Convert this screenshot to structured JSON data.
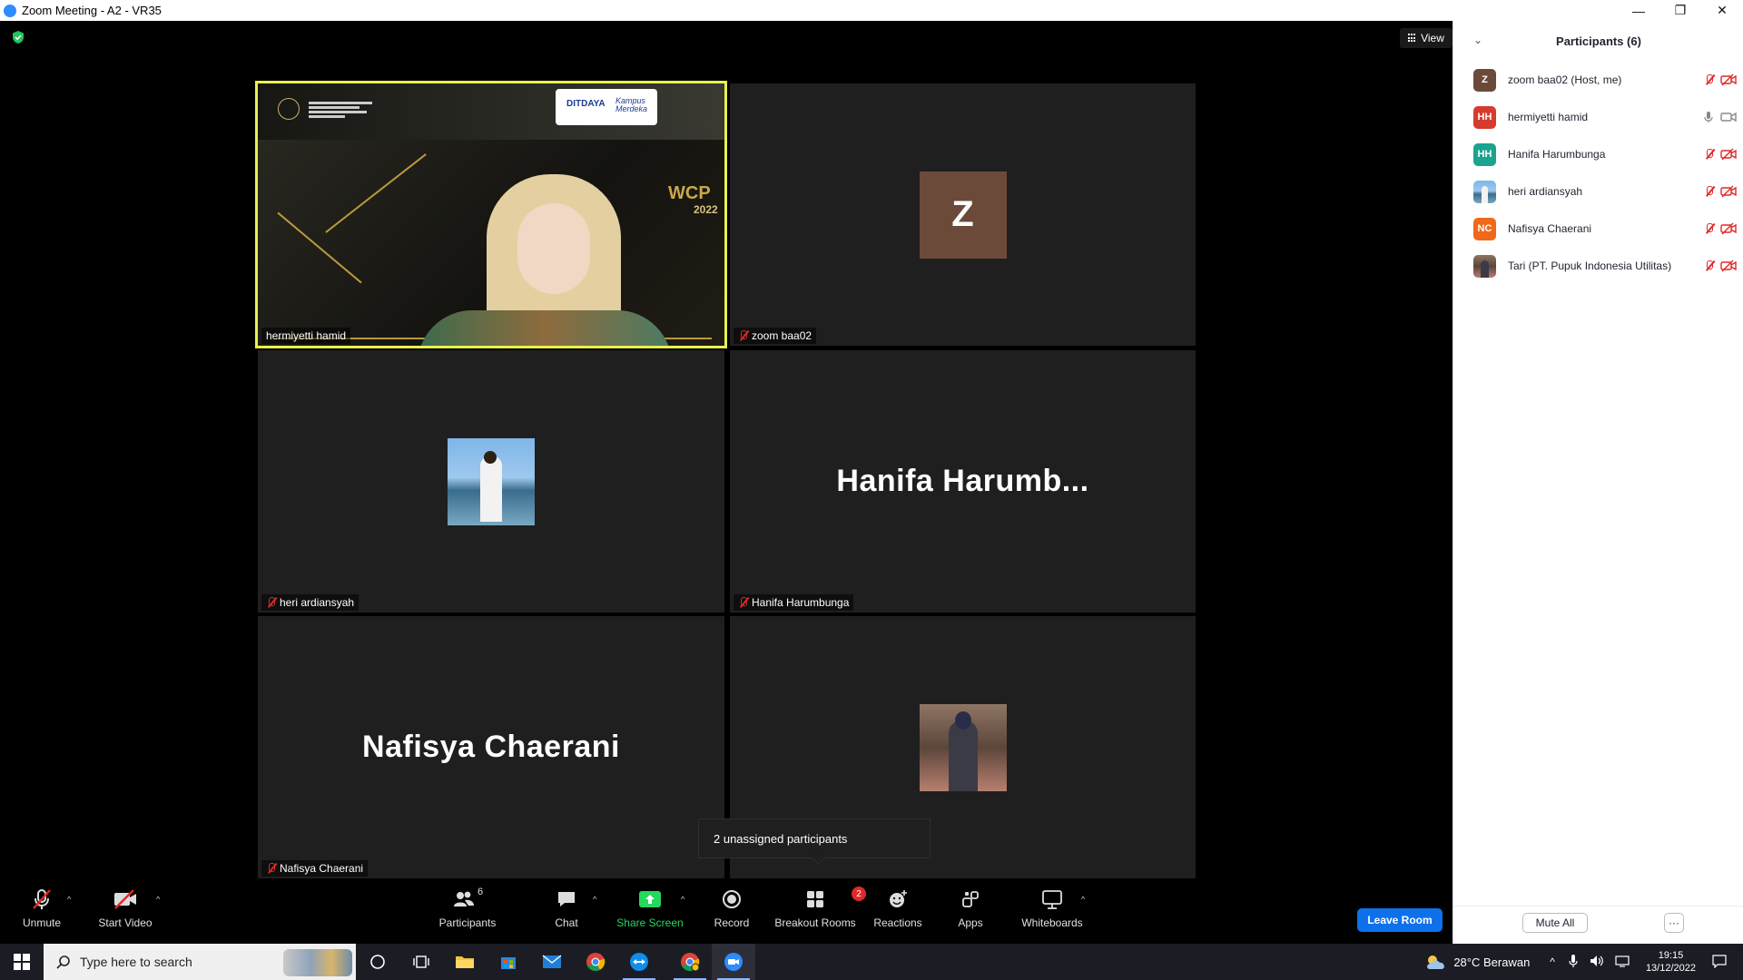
{
  "window": {
    "title": "Zoom Meeting - A2 - VR35",
    "controls": [
      "—",
      "❐",
      "✕"
    ]
  },
  "meeting": {
    "view_label": "View",
    "tiles": [
      {
        "name": "hermiyetti hamid",
        "type": "video",
        "muted": false,
        "active": true
      },
      {
        "name": "zoom baa02",
        "type": "initial",
        "initial": "Z",
        "muted": true
      },
      {
        "name": "heri ardiansyah",
        "type": "photo",
        "muted": true
      },
      {
        "name": "Hanifa Harumbunga",
        "type": "text",
        "display": "Hanifa  Harumb...",
        "muted": true
      },
      {
        "name": "Nafisya Chaerani",
        "type": "text",
        "display": "Nafisya Chaerani",
        "muted": true
      },
      {
        "name": "",
        "type": "photo",
        "muted": false
      }
    ],
    "video_overlay": {
      "logo_left": "DITDAYA",
      "logo_right": "Kampus Merdeka",
      "wcp": "WCP",
      "year": "2022"
    },
    "toast": "2 unassigned participants"
  },
  "toolbar": {
    "unmute": "Unmute",
    "start_video": "Start Video",
    "participants": "Participants",
    "participants_count": "6",
    "chat": "Chat",
    "share_screen": "Share Screen",
    "record": "Record",
    "breakout_rooms": "Breakout Rooms",
    "breakout_badge": "2",
    "reactions": "Reactions",
    "apps": "Apps",
    "whiteboards": "Whiteboards",
    "leave_room": "Leave Room"
  },
  "panel": {
    "title": "Participants (6)",
    "participants": [
      {
        "name": "zoom baa02 (Host, me)",
        "initials": "Z",
        "color": "#6b4a3a",
        "mic": "muted",
        "cam": "off"
      },
      {
        "name": "hermiyetti hamid",
        "initials": "HH",
        "color": "#d63b2e",
        "mic": "on",
        "cam": "on"
      },
      {
        "name": "Hanifa Harumbunga",
        "initials": "HH",
        "color": "#1aa38e",
        "mic": "muted",
        "cam": "off"
      },
      {
        "name": "heri ardiansyah",
        "initials": "",
        "color": "#8fb6d8",
        "mic": "muted",
        "cam": "off"
      },
      {
        "name": "Nafisya Chaerani",
        "initials": "NC",
        "color": "#f0681a",
        "mic": "muted",
        "cam": "off"
      },
      {
        "name": "Tari (PT. Pupuk Indonesia Utilitas)",
        "initials": "",
        "color": "#6e5b57",
        "mic": "muted",
        "cam": "off"
      }
    ],
    "mute_all": "Mute All",
    "more": "···"
  },
  "taskbar": {
    "search_placeholder": "Type here to search",
    "weather": "28°C  Berawan",
    "time": "19:15",
    "date": "13/12/2022"
  },
  "colors": {
    "active_speaker": "#e9f04f",
    "leave_room": "#0e71eb",
    "share_green": "#23d95e",
    "mic_off_red": "#e02828"
  }
}
